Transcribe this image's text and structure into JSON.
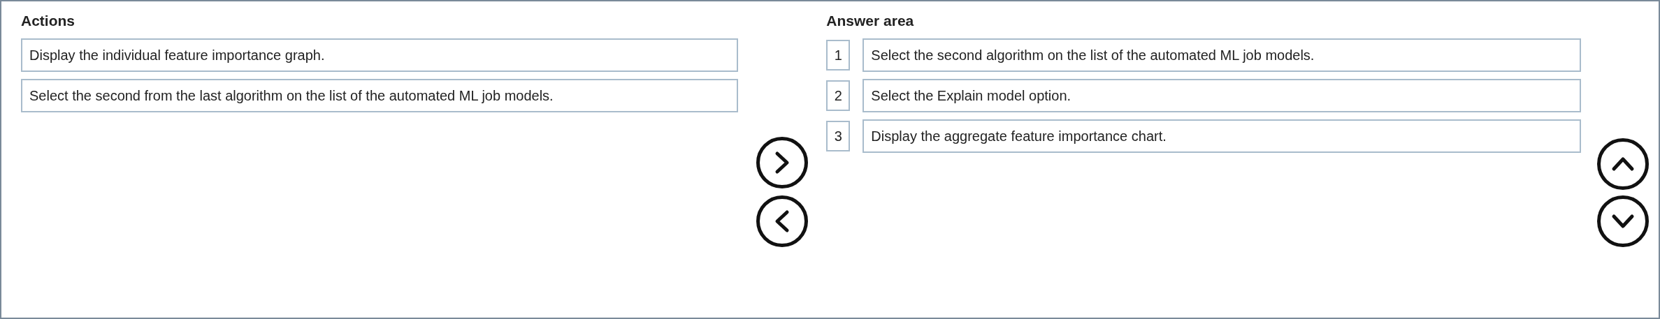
{
  "actions": {
    "title": "Actions",
    "items": [
      {
        "text": "Display the individual feature importance graph."
      },
      {
        "text": "Select the second from the last algorithm on the list of the automated ML job models."
      }
    ]
  },
  "answer_area": {
    "title": "Answer area",
    "items": [
      {
        "number": "1",
        "text": "Select the second algorithm on the list of the automated ML job models."
      },
      {
        "number": "2",
        "text": "Select the Explain model option."
      },
      {
        "number": "3",
        "text": "Display the aggregate feature importance chart."
      }
    ]
  }
}
